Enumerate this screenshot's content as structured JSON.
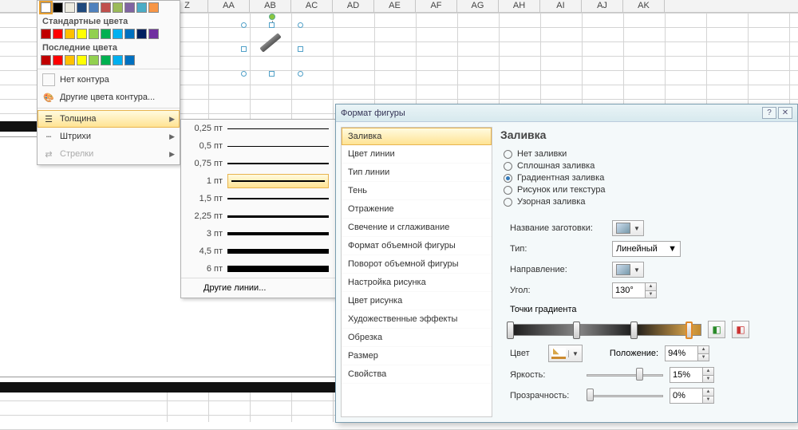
{
  "columns": [
    "Z",
    "AA",
    "AB",
    "AC",
    "AD",
    "AE",
    "AF",
    "AG",
    "AH",
    "AI",
    "AJ",
    "AK"
  ],
  "color_menu": {
    "std_label": "Стандартные цвета",
    "recent_label": "Последние цвета",
    "theme_colors": [
      "#ffffff",
      "#000000",
      "#eeece1",
      "#1f497d",
      "#4f81bd",
      "#c0504d",
      "#9bbb59",
      "#8064a2",
      "#4bacc6",
      "#f79646"
    ],
    "std_colors": [
      "#c00000",
      "#ff0000",
      "#ffc000",
      "#ffff00",
      "#92d050",
      "#00b050",
      "#00b0f0",
      "#0070c0",
      "#002060",
      "#7030a0"
    ],
    "recent_colors": [
      "#c00000",
      "#ff0000",
      "#ffc000",
      "#ffff00",
      "#92d050",
      "#00b050",
      "#00b0f0",
      "#0070c0"
    ],
    "no_outline": "Нет контура",
    "more_colors": "Другие цвета контура...",
    "thickness": "Толщина",
    "dashes": "Штрихи",
    "arrows": "Стрелки"
  },
  "thickness": {
    "items": [
      {
        "label": "0,25 пт",
        "w": 0.5
      },
      {
        "label": "0,5 пт",
        "w": 1
      },
      {
        "label": "0,75 пт",
        "w": 1.25
      },
      {
        "label": "1 пт",
        "w": 1.5,
        "selected": true
      },
      {
        "label": "1,5 пт",
        "w": 2
      },
      {
        "label": "2,25 пт",
        "w": 3
      },
      {
        "label": "3 пт",
        "w": 4
      },
      {
        "label": "4,5 пт",
        "w": 6
      },
      {
        "label": "6 пт",
        "w": 8
      }
    ],
    "more": "Другие линии..."
  },
  "dialog": {
    "title": "Формат фигуры",
    "categories": [
      "Заливка",
      "Цвет линии",
      "Тип линии",
      "Тень",
      "Отражение",
      "Свечение и сглаживание",
      "Формат объемной фигуры",
      "Поворот объемной фигуры",
      "Настройка рисунка",
      "Цвет рисунка",
      "Художественные эффекты",
      "Обрезка",
      "Размер",
      "Свойства"
    ],
    "selected_category": 0,
    "heading": "Заливка",
    "radios": [
      "Нет заливки",
      "Сплошная заливка",
      "Градиентная заливка",
      "Рисунок или текстура",
      "Узорная заливка"
    ],
    "radio_selected": 2,
    "preset_label": "Название заготовки:",
    "type_label": "Тип:",
    "type_value": "Линейный",
    "direction_label": "Направление:",
    "angle_label": "Угол:",
    "angle_value": "130°",
    "gradstops_label": "Точки градиента",
    "stops": [
      0,
      35,
      65,
      94
    ],
    "selected_stop": 3,
    "color_label": "Цвет",
    "position_label": "Положение:",
    "position_value": "94%",
    "brightness_label": "Яркость:",
    "brightness_value": "15%",
    "brightness_thumb": 62,
    "transparency_label": "Прозрачность:",
    "transparency_value": "0%",
    "transparency_thumb": 0
  }
}
